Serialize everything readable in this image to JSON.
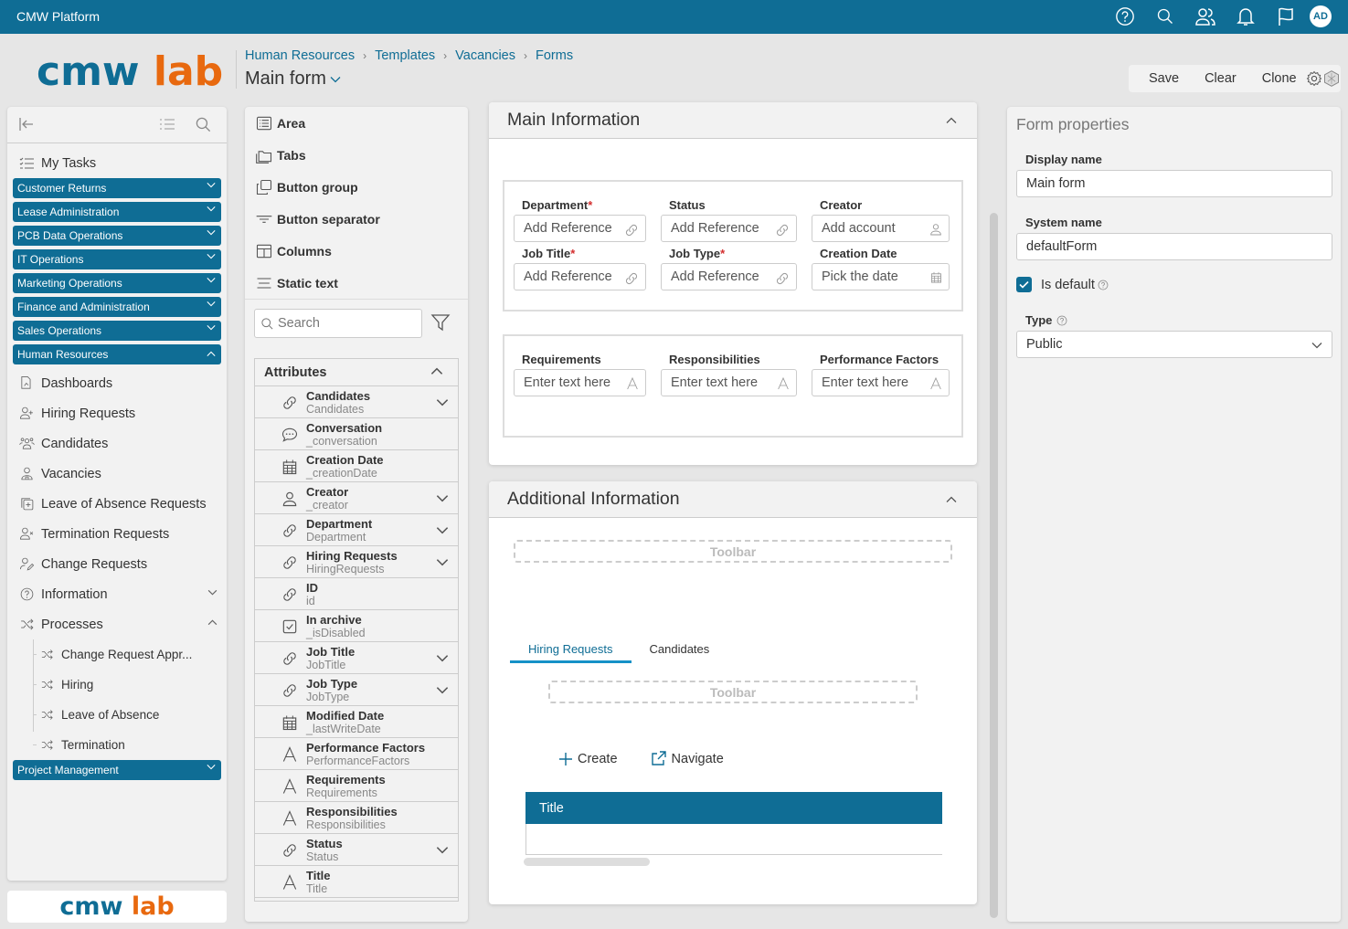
{
  "app": {
    "title": "CMW Platform",
    "logo_part1": "cmw",
    "logo_part2": "lab",
    "user_initials": "AD",
    "top_icons": [
      "help-icon",
      "search-icon",
      "users-icon",
      "bell-icon",
      "flag-icon"
    ]
  },
  "colors": {
    "brand_blue": "#0f6d95",
    "brand_orange": "#e8690f",
    "required": "#d32f2f",
    "tab_underline": "#1591c7"
  },
  "header": {
    "breadcrumb": [
      "Human Resources",
      "Templates",
      "Vacancies",
      "Forms"
    ],
    "title": "Main form",
    "actions": {
      "save": "Save",
      "clear": "Clear",
      "clone": "Clone"
    }
  },
  "sidebar": {
    "my_tasks": "My Tasks",
    "groups_before": [
      "Customer Returns",
      "Lease Administration",
      "PCB Data Operations",
      "IT Operations",
      "Marketing Operations",
      "Finance and Administration",
      "Sales Operations"
    ],
    "expanded_group": "Human Resources",
    "items": [
      {
        "label": "Dashboards",
        "icon": "dashboard-icon"
      },
      {
        "label": "Hiring Requests",
        "icon": "user-plus-icon"
      },
      {
        "label": "Candidates",
        "icon": "users-group-icon"
      },
      {
        "label": "Vacancies",
        "icon": "vacancy-icon"
      },
      {
        "label": "Leave of Absence Requests",
        "icon": "leave-icon"
      },
      {
        "label": "Termination Requests",
        "icon": "user-x-icon"
      },
      {
        "label": "Change Requests",
        "icon": "user-edit-icon"
      },
      {
        "label": "Information",
        "icon": "help-circle-icon"
      },
      {
        "label": "Processes",
        "icon": "shuffle-icon"
      }
    ],
    "processes": [
      "Change Request Appr...",
      "Hiring",
      "Leave of Absence",
      "Termination"
    ],
    "groups_after": [
      "Project Management"
    ]
  },
  "components": {
    "items": [
      {
        "label": "Area",
        "icon": "area-icon"
      },
      {
        "label": "Tabs",
        "icon": "tabs-icon"
      },
      {
        "label": "Button group",
        "icon": "button-group-icon"
      },
      {
        "label": "Button separator",
        "icon": "separator-icon"
      },
      {
        "label": "Columns",
        "icon": "columns-icon"
      },
      {
        "label": "Static text",
        "icon": "static-text-icon"
      }
    ],
    "search_placeholder": "Search",
    "attributes_title": "Attributes",
    "attributes": [
      {
        "name": "Candidates",
        "system": "Candidates",
        "type": "link",
        "expandable": true
      },
      {
        "name": "Conversation",
        "system": "_conversation",
        "type": "chat",
        "expandable": false
      },
      {
        "name": "Creation Date",
        "system": "_creationDate",
        "type": "date",
        "expandable": false
      },
      {
        "name": "Creator",
        "system": "_creator",
        "type": "account",
        "expandable": true
      },
      {
        "name": "Department",
        "system": "Department",
        "type": "link",
        "expandable": true
      },
      {
        "name": "Hiring Requests",
        "system": "HiringRequests",
        "type": "link",
        "expandable": true
      },
      {
        "name": "ID",
        "system": "id",
        "type": "link",
        "expandable": false
      },
      {
        "name": "In archive",
        "system": "_isDisabled",
        "type": "bool",
        "expandable": false
      },
      {
        "name": "Job Title",
        "system": "JobTitle",
        "type": "link",
        "expandable": true
      },
      {
        "name": "Job Type",
        "system": "JobType",
        "type": "link",
        "expandable": true
      },
      {
        "name": "Modified Date",
        "system": "_lastWriteDate",
        "type": "date",
        "expandable": false
      },
      {
        "name": "Performance Factors",
        "system": "PerformanceFactors",
        "type": "text",
        "expandable": false
      },
      {
        "name": "Requirements",
        "system": "Requirements",
        "type": "text",
        "expandable": false
      },
      {
        "name": "Responsibilities",
        "system": "Responsibilities",
        "type": "text",
        "expandable": false
      },
      {
        "name": "Status",
        "system": "Status",
        "type": "link",
        "expandable": true
      },
      {
        "name": "Title",
        "system": "Title",
        "type": "text",
        "expandable": false
      }
    ]
  },
  "canvas": {
    "main_info": {
      "title": "Main Information",
      "fields": [
        {
          "label": "Department",
          "required": true,
          "placeholder": "Add Reference",
          "icon": "link"
        },
        {
          "label": "Status",
          "required": false,
          "placeholder": "Add Reference",
          "icon": "link"
        },
        {
          "label": "Creator",
          "required": false,
          "placeholder": "Add account",
          "icon": "account"
        },
        {
          "label": "Job Title",
          "required": true,
          "placeholder": "Add Reference",
          "icon": "link"
        },
        {
          "label": "Job Type",
          "required": true,
          "placeholder": "Add Reference",
          "icon": "link"
        },
        {
          "label": "Creation Date",
          "required": false,
          "placeholder": "Pick the date",
          "icon": "date"
        }
      ],
      "text_fields": [
        {
          "label": "Requirements",
          "placeholder": "Enter text here"
        },
        {
          "label": "Responsibilities",
          "placeholder": "Enter text here"
        },
        {
          "label": "Performance Factors",
          "placeholder": "Enter text here"
        }
      ]
    },
    "additional_info": {
      "title": "Additional Information",
      "toolbar_label": "Toolbar",
      "tabs": [
        {
          "label": "Hiring Requests",
          "active": true
        },
        {
          "label": "Candidates",
          "active": false
        }
      ],
      "inner_toolbar_label": "Toolbar",
      "create_label": "Create",
      "navigate_label": "Navigate",
      "table_columns": [
        "Title"
      ]
    }
  },
  "properties": {
    "title": "Form properties",
    "display_name_label": "Display name",
    "display_name_value": "Main form",
    "system_name_label": "System name",
    "system_name_value": "defaultForm",
    "is_default_label": "Is default",
    "is_default_checked": true,
    "type_label": "Type",
    "type_value": "Public"
  }
}
